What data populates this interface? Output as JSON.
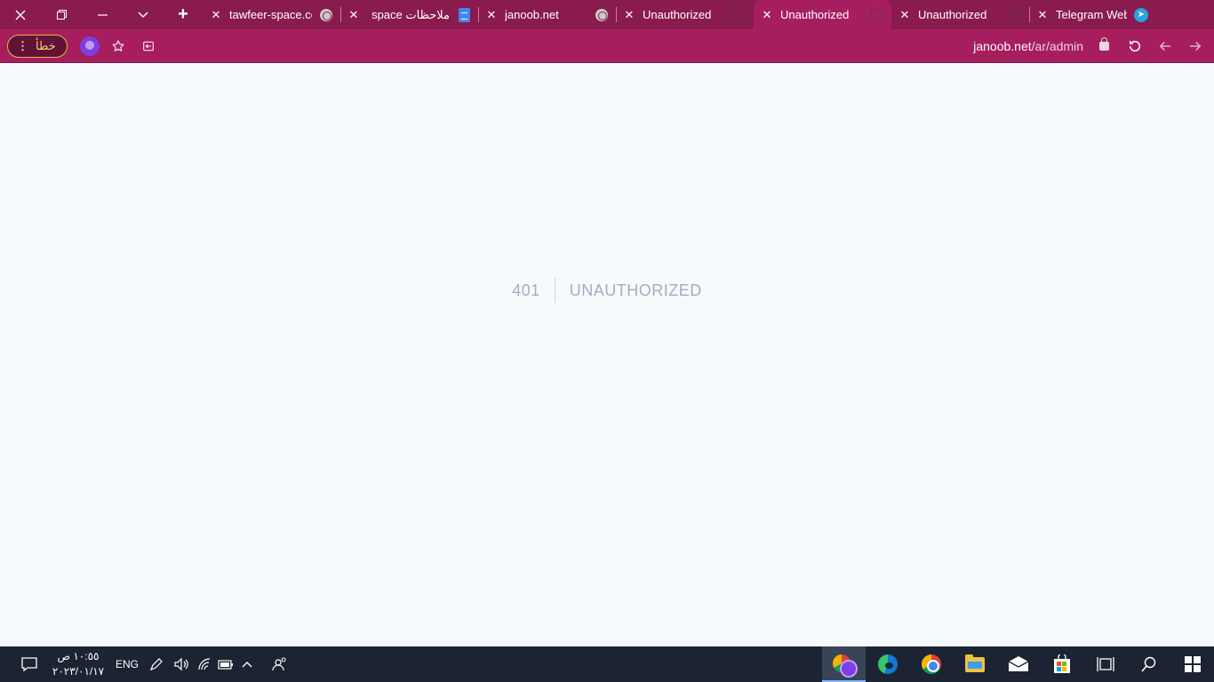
{
  "browser": {
    "colors": {
      "tabstrip": "#8a1b4e",
      "toolbar": "#a71e5e",
      "error_pill_border": "#e8b93e"
    },
    "window_controls": [
      {
        "name": "close-window-button",
        "icon": "close-icon"
      },
      {
        "name": "restore-window-button",
        "icon": "restore-icon"
      },
      {
        "name": "minimize-window-button",
        "icon": "minimize-icon"
      },
      {
        "name": "tab-search-button",
        "icon": "chevron-down-icon"
      }
    ],
    "new_tab_label": "+",
    "tabs": [
      {
        "title": "tawfeer-space.co",
        "favicon": "globe-icon",
        "active": false
      },
      {
        "title": "ملاحظات space",
        "favicon": "google-docs-icon",
        "active": false
      },
      {
        "title": "janoob.net",
        "favicon": "globe-icon",
        "active": false
      },
      {
        "title": "Unauthorized",
        "favicon": "site-icon",
        "active": false
      },
      {
        "title": "Unauthorized",
        "favicon": "site-icon",
        "active": true
      },
      {
        "title": "Unauthorized",
        "favicon": "site-icon",
        "active": false
      },
      {
        "title": "Telegram Web",
        "favicon": "telegram-icon",
        "active": false
      }
    ],
    "toolbar": {
      "error_label": "خطأ",
      "url_host": "janoob.net",
      "url_path": "/ar/admin"
    }
  },
  "page": {
    "error_code": "401",
    "error_message": "UNAUTHORIZED"
  },
  "taskbar": {
    "clock_time": "١٠:٥٥ ص",
    "clock_date": "٢٠٢٣/٠١/١٧",
    "language": "ENG",
    "tray_icons": [
      "notification-icon",
      "pen-icon",
      "volume-icon",
      "wifi-icon",
      "battery-icon",
      "chevron-up-icon",
      "people-icon"
    ],
    "apps": [
      "browser-multi-icon",
      "edge-icon",
      "chrome-icon",
      "file-explorer-icon",
      "mail-icon",
      "store-icon",
      "task-view-icon",
      "search-icon",
      "start-icon"
    ]
  }
}
